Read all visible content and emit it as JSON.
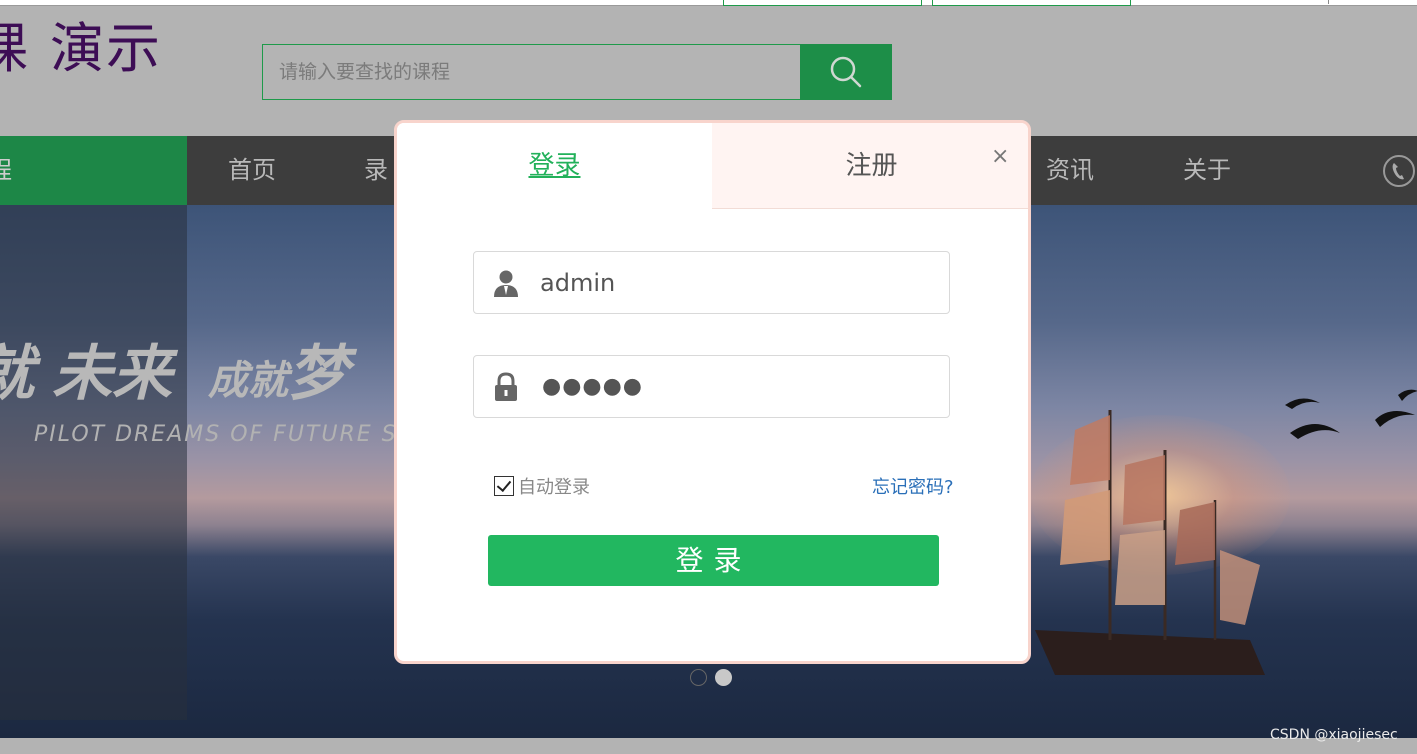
{
  "header": {
    "logo_text": "演示",
    "search_placeholder": "请输入要查找的课程",
    "search_icon": "search-icon"
  },
  "nav": {
    "active_label": "程",
    "items": [
      "首页",
      "录",
      "资讯",
      "关于"
    ],
    "phone_icon": "phone-icon"
  },
  "banner": {
    "slogan_left": "未来",
    "slogan_right_small": "成就",
    "slogan_right_big": "梦",
    "slogan_en": "PILOT DREAMS OF FUTURE S",
    "active_dot": 2,
    "dot_count": 2
  },
  "modal": {
    "tabs": {
      "login": "登录",
      "register": "注册"
    },
    "close": "×",
    "username": "admin",
    "password_mask": "●●●●●",
    "user_icon": "user-icon",
    "lock_icon": "lock-icon",
    "remember_label": "自动登录",
    "remember_checked": true,
    "forgot_label": "忘记密码?",
    "submit_label": "登录"
  },
  "watermark": "CSDN @xiaojiesec",
  "colors": {
    "brand_green": "#22b760",
    "link_blue": "#2a6fb8",
    "nav_bg": "#3d3d3d"
  }
}
